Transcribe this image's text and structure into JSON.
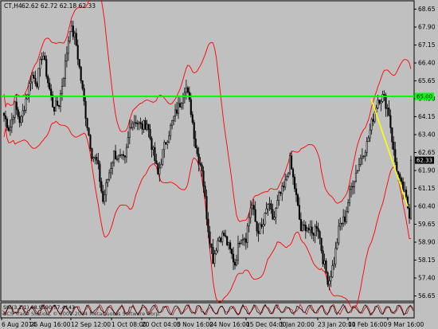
{
  "header": {
    "symbol_timeframe": "CT,H4",
    "ohlc": "62.62 62.72 62.18 62.33"
  },
  "sub_indicator": {
    "label": "Sto(3,1,1) 68.9590 57.4143",
    "watermark": "© 2001-2014 MetaQuotes Software Corp."
  },
  "watermark_main": "BCS Trade Station, © 2001-2014 MetaQuotes Software Corp.",
  "colors": {
    "background": "#c0c0c0",
    "candles": "#000000",
    "bands": "#ff0000",
    "horizontal_line": "#00ff00",
    "trendline": "#ffff00",
    "current_price_bg": "#000000"
  },
  "chart_data": {
    "type": "candlestick",
    "price_axis_ticks": [
      "68.65",
      "67.90",
      "67.15",
      "66.40",
      "65.65",
      "64.90",
      "64.15",
      "63.40",
      "62.65",
      "61.90",
      "61.15",
      "60.40",
      "59.65",
      "58.90",
      "58.15",
      "57.40",
      "56.65"
    ],
    "ylim": [
      56.5,
      68.9
    ],
    "current_price": "62.33",
    "horizontal_line_price": "65.00",
    "horizontal_line_label": "65.00",
    "time_axis_labels": [
      "6 Aug 2014",
      "25 Aug 16:00",
      "12 Sep 12:00",
      "1 Oct 08:00",
      "20 Oct 04:00",
      "5 Nov 16:00",
      "24 Nov 16:00",
      "15 Dec 04:00",
      "5 Jan 20:00",
      "23 Jan 20:00",
      "11 Feb 16:00",
      "9 Mar 16:00"
    ],
    "price_path": [
      64.2,
      63.6,
      64.6,
      63.9,
      64.9,
      65.9,
      65.6,
      66.9,
      65.6,
      64.5,
      64.7,
      66.1,
      67.9,
      67.4,
      65.7,
      64.0,
      62.6,
      62.2,
      60.6,
      61.7,
      62.6,
      62.4,
      62.3,
      63.9,
      64.0,
      63.7,
      63.9,
      62.8,
      61.7,
      62.8,
      63.5,
      64.2,
      64.7,
      65.5,
      64.4,
      62.7,
      62.0,
      59.7,
      58.2,
      59.1,
      59.2,
      58.6,
      58.0,
      59.2,
      59.1,
      60.6,
      59.4,
      59.5,
      60.5,
      59.8,
      60.8,
      61.2,
      62.3,
      61.0,
      59.4,
      59.6,
      59.2,
      59.7,
      58.2,
      57.2,
      58.1,
      59.6,
      59.9,
      61.1,
      61.8,
      62.5,
      63.0,
      64.0,
      64.9,
      65.0,
      64.3,
      62.4,
      61.4,
      60.8,
      59.8
    ],
    "yellow_trendline": [
      [
        64.9
      ],
      [
        60.4
      ]
    ]
  }
}
